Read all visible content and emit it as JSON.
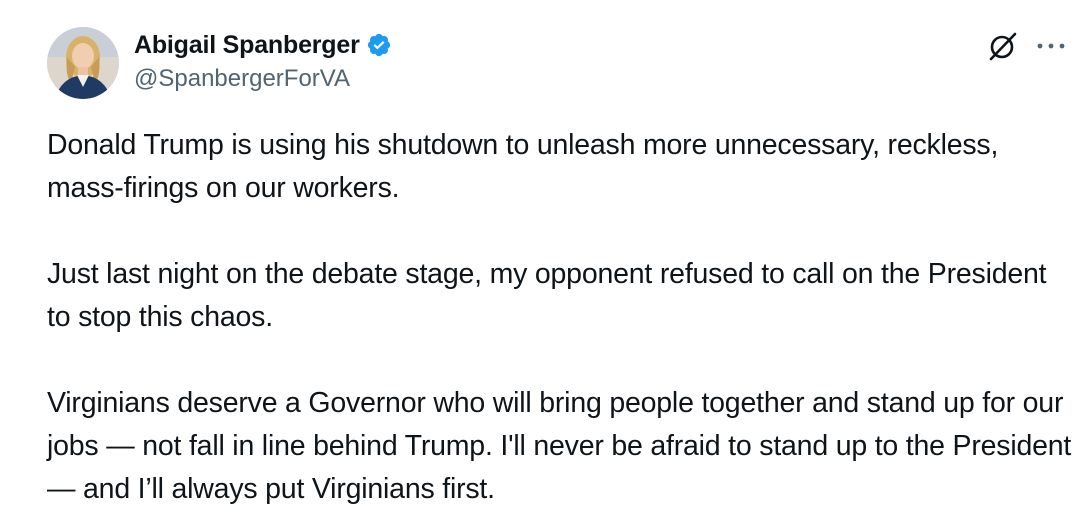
{
  "author": {
    "display_name": "Abigail Spanberger",
    "handle": "@SpanbergerForVA",
    "verified": true
  },
  "icons": {
    "verified": "verified-badge-icon",
    "grok": "grok-icon",
    "more": "more-icon"
  },
  "colors": {
    "text": "#0f1419",
    "secondary": "#536471",
    "verified_blue": "#1d9bf0"
  },
  "tweet": {
    "paragraphs": [
      "Donald Trump is using his shutdown to unleash more unnecessary, reckless, mass-firings on our workers.",
      "Just last night on the debate stage, my opponent refused to call on the President to stop this chaos.",
      "Virginians deserve a Governor who will bring people together and stand up for our jobs — not fall in line behind Trump. I'll never be afraid to stand up to the President — and I’ll always put Virginians first."
    ]
  }
}
